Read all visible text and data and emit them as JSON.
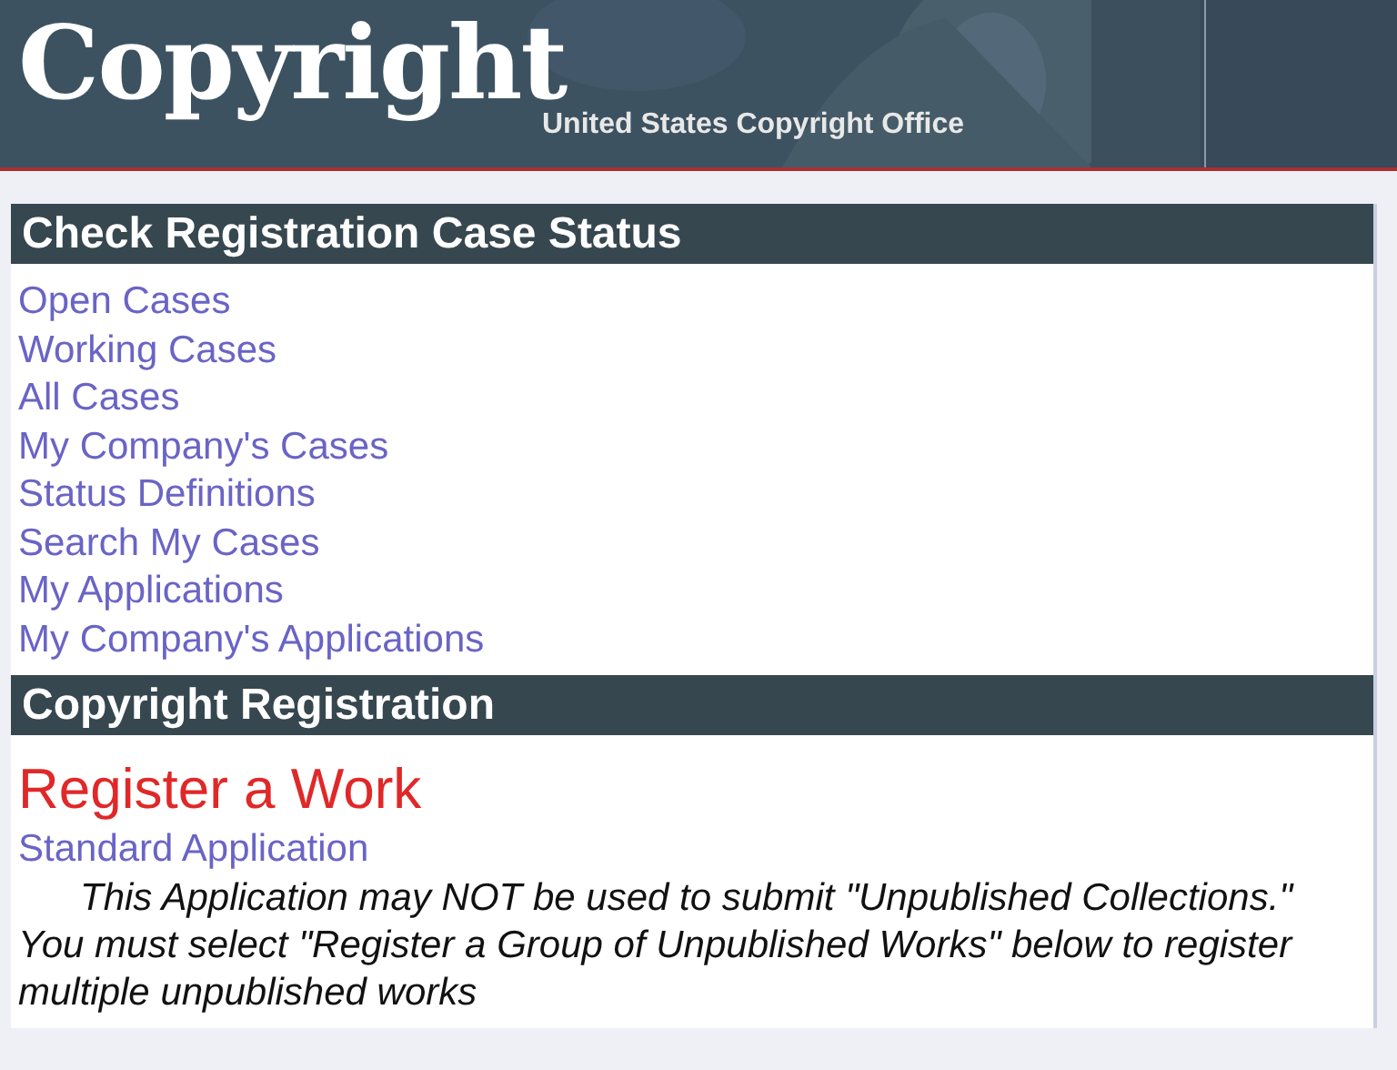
{
  "header": {
    "logo": "Copyright",
    "subtitle": "United States Copyright Office"
  },
  "sections": [
    {
      "title": "Check Registration Case Status",
      "links": [
        "Open Cases",
        "Working Cases",
        "All Cases",
        "My Company's Cases",
        "Status Definitions",
        "Search My Cases",
        "My Applications",
        "My Company's Applications"
      ]
    },
    {
      "title": "Copyright Registration",
      "heading": "Register a Work",
      "links": [
        "Standard Application"
      ],
      "note": "This Application may NOT be used to submit \"Unpublished Collections.\" You must select \"Register a Group of Unpublished Works\" below to register multiple unpublished works"
    }
  ]
}
